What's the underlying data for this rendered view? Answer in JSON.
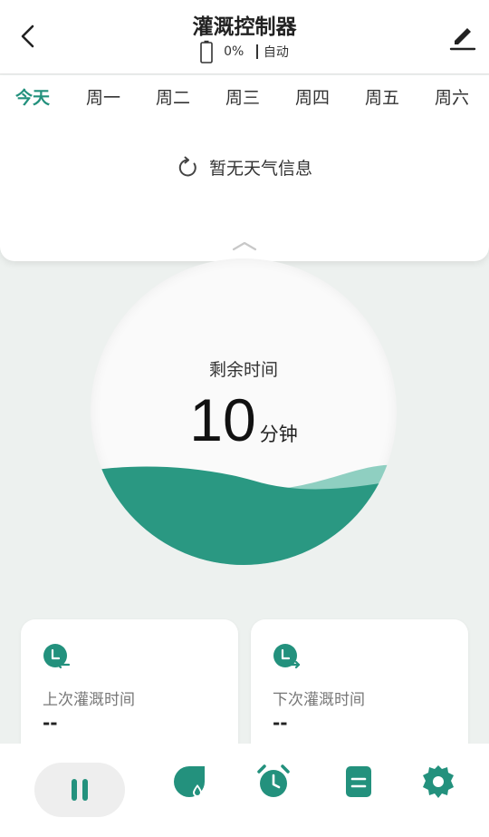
{
  "header": {
    "title": "灌溉控制器",
    "battery_percent": "0%",
    "mode": "自动",
    "back_icon": "chevron-left-icon",
    "edit_icon": "pencil-icon"
  },
  "tabs": [
    {
      "label": "今天",
      "active": true
    },
    {
      "label": "周一",
      "active": false
    },
    {
      "label": "周二",
      "active": false
    },
    {
      "label": "周三",
      "active": false
    },
    {
      "label": "周四",
      "active": false
    },
    {
      "label": "周五",
      "active": false
    },
    {
      "label": "周六",
      "active": false
    }
  ],
  "weather": {
    "message": "暂无天气信息",
    "icon": "refresh-icon"
  },
  "gauge": {
    "label": "剩余时间",
    "value": "10",
    "unit": "分钟"
  },
  "cards": {
    "last": {
      "label": "上次灌溉时间",
      "value": "--",
      "icon": "clock-left-arrow-icon"
    },
    "next": {
      "label": "下次灌溉时间",
      "value": "--",
      "icon": "clock-right-arrow-icon"
    }
  },
  "bottom_nav": {
    "items": [
      "pause-icon",
      "water-drop-icon",
      "alarm-clock-icon",
      "document-icon",
      "settings-gear-icon"
    ]
  },
  "colors": {
    "accent": "#23917d",
    "background": "#edf1ef",
    "wave_dark": "#2a9882",
    "wave_light": "#8fcfc1"
  }
}
